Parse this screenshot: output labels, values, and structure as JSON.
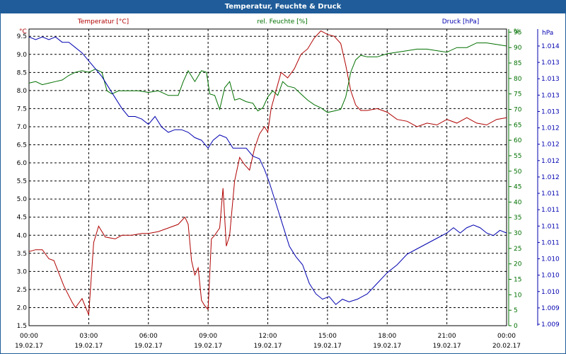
{
  "window": {
    "title": "Temperatur, Feuchte & Druck"
  },
  "colors": {
    "temperature": "#b00000",
    "humidity": "#007000",
    "pressure": "#0000b0",
    "grid": "#000000"
  },
  "chart_data": {
    "type": "line",
    "title": "Temperatur, Feuchte & Druck",
    "grid": true,
    "x": {
      "range": [
        "19.02.17 00:00",
        "20.02.17 00:00"
      ],
      "ticks": [
        {
          "time": "00:00",
          "date": "19.02.17"
        },
        {
          "time": "03:00",
          "date": "19.02.17"
        },
        {
          "time": "06:00",
          "date": "19.02.17"
        },
        {
          "time": "09:00",
          "date": "19.02.17"
        },
        {
          "time": "12:00",
          "date": "19.02.17"
        },
        {
          "time": "15:00",
          "date": "19.02.17"
        },
        {
          "time": "18:00",
          "date": "19.02.17"
        },
        {
          "time": "21:00",
          "date": "19.02.17"
        },
        {
          "time": "00:00",
          "date": "20.02.17"
        }
      ]
    },
    "axes": {
      "temperature": {
        "unit": "°C",
        "range": [
          1.5,
          9.7
        ],
        "ticks": [
          "9.5",
          "9.0",
          "8.5",
          "8.0",
          "7.5",
          "7.0",
          "6.5",
          "6.0",
          "5.5",
          "5.0",
          "4.5",
          "4.0",
          "3.5",
          "3.0",
          "2.5",
          "2.0",
          "1.5"
        ]
      },
      "humidity": {
        "unit": "%",
        "range": [
          0,
          96
        ],
        "ticks": [
          "95",
          "90",
          "85",
          "80",
          "75",
          "70",
          "65",
          "60",
          "55",
          "50",
          "45",
          "40",
          "35",
          "30",
          "25",
          "20",
          "15",
          "10",
          "5",
          "0"
        ]
      },
      "pressure": {
        "unit": "hPa",
        "range": [
          1008.6,
          1014.2
        ],
        "ticks": [
          "1.014",
          "1.013",
          "1.013",
          "1.013",
          "1.013",
          "1.012",
          "1.012",
          "1.012",
          "1.012",
          "1.011",
          "1.011",
          "1.011",
          "1.011",
          "1.010",
          "1.010",
          "1.010",
          "1.009",
          "1.009"
        ]
      }
    },
    "series": [
      {
        "name": "Temperatur [°C]",
        "axis": "temperature",
        "points": [
          [
            "19.02.17 00:00",
            3.55
          ],
          [
            "19.02.17 00:20",
            3.6
          ],
          [
            "19.02.17 00:40",
            3.6
          ],
          [
            "19.02.17 01:00",
            3.35
          ],
          [
            "19.02.17 01:15",
            3.3
          ],
          [
            "19.02.17 01:45",
            2.6
          ],
          [
            "19.02.17 02:10",
            2.15
          ],
          [
            "19.02.17 02:20",
            2.0
          ],
          [
            "19.02.17 02:40",
            2.25
          ],
          [
            "19.02.17 03:00",
            1.8
          ],
          [
            "19.02.17 03:15",
            3.8
          ],
          [
            "19.02.17 03:30",
            4.25
          ],
          [
            "19.02.17 03:50",
            3.95
          ],
          [
            "19.02.17 04:20",
            3.9
          ],
          [
            "19.02.17 04:40",
            4.0
          ],
          [
            "19.02.17 05:10",
            4.0
          ],
          [
            "19.02.17 05:40",
            4.05
          ],
          [
            "19.02.17 06:00",
            4.05
          ],
          [
            "19.02.17 06:30",
            4.1
          ],
          [
            "19.02.17 07:00",
            4.2
          ],
          [
            "19.02.17 07:30",
            4.3
          ],
          [
            "19.02.17 07:50",
            4.5
          ],
          [
            "19.02.17 08:00",
            4.3
          ],
          [
            "19.02.17 08:10",
            3.3
          ],
          [
            "19.02.17 08:20",
            2.9
          ],
          [
            "19.02.17 08:30",
            3.1
          ],
          [
            "19.02.17 08:40",
            2.2
          ],
          [
            "19.02.17 08:50",
            2.05
          ],
          [
            "19.02.17 09:00",
            1.95
          ],
          [
            "19.02.17 09:10",
            3.9
          ],
          [
            "19.02.17 09:20",
            4.0
          ],
          [
            "19.02.17 09:35",
            4.2
          ],
          [
            "19.02.17 09:45",
            5.3
          ],
          [
            "19.02.17 09:55",
            3.7
          ],
          [
            "19.02.17 10:05",
            4.0
          ],
          [
            "19.02.17 10:20",
            5.5
          ],
          [
            "19.02.17 10:35",
            6.15
          ],
          [
            "19.02.17 10:50",
            5.95
          ],
          [
            "19.02.17 11:05",
            5.8
          ],
          [
            "19.02.17 11:20",
            6.4
          ],
          [
            "19.02.17 11:35",
            6.8
          ],
          [
            "19.02.17 11:50",
            7.0
          ],
          [
            "19.02.17 12:00",
            6.85
          ],
          [
            "19.02.17 12:10",
            7.5
          ],
          [
            "19.02.17 12:25",
            8.0
          ],
          [
            "19.02.17 12:40",
            8.5
          ],
          [
            "19.02.17 13:00",
            8.35
          ],
          [
            "19.02.17 13:20",
            8.6
          ],
          [
            "19.02.17 13:40",
            9.0
          ],
          [
            "19.02.17 14:00",
            9.15
          ],
          [
            "19.02.17 14:20",
            9.45
          ],
          [
            "19.02.17 14:40",
            9.65
          ],
          [
            "19.02.17 15:00",
            9.55
          ],
          [
            "19.02.17 15:20",
            9.5
          ],
          [
            "19.02.17 15:40",
            9.3
          ],
          [
            "19.02.17 15:55",
            8.7
          ],
          [
            "19.02.17 16:10",
            8.0
          ],
          [
            "19.02.17 16:25",
            7.6
          ],
          [
            "19.02.17 16:40",
            7.45
          ],
          [
            "19.02.17 17:00",
            7.45
          ],
          [
            "19.02.17 17:30",
            7.5
          ],
          [
            "19.02.17 18:00",
            7.4
          ],
          [
            "19.02.17 18:30",
            7.2
          ],
          [
            "19.02.17 19:00",
            7.15
          ],
          [
            "19.02.17 19:30",
            7.0
          ],
          [
            "19.02.17 20:00",
            7.1
          ],
          [
            "19.02.17 20:30",
            7.05
          ],
          [
            "19.02.17 21:00",
            7.2
          ],
          [
            "19.02.17 21:30",
            7.1
          ],
          [
            "19.02.17 22:00",
            7.25
          ],
          [
            "19.02.17 22:30",
            7.1
          ],
          [
            "19.02.17 23:00",
            7.05
          ],
          [
            "19.02.17 23:30",
            7.2
          ],
          [
            "20.02.17 00:00",
            7.25
          ]
        ]
      },
      {
        "name": "rel. Feuchte [%]",
        "axis": "humidity",
        "points": [
          [
            "19.02.17 00:00",
            78.5
          ],
          [
            "19.02.17 00:20",
            79.0
          ],
          [
            "19.02.17 00:40",
            78.0
          ],
          [
            "19.02.17 01:00",
            78.5
          ],
          [
            "19.02.17 01:20",
            79.0
          ],
          [
            "19.02.17 01:40",
            79.5
          ],
          [
            "19.02.17 02:00",
            81.0
          ],
          [
            "19.02.17 02:20",
            82.0
          ],
          [
            "19.02.17 02:40",
            82.5
          ],
          [
            "19.02.17 03:00",
            82.0
          ],
          [
            "19.02.17 03:20",
            83.0
          ],
          [
            "19.02.17 03:40",
            82.0
          ],
          [
            "19.02.17 03:55",
            76.0
          ],
          [
            "19.02.17 04:10",
            75.0
          ],
          [
            "19.02.17 04:30",
            76.0
          ],
          [
            "19.02.17 05:00",
            76.0
          ],
          [
            "19.02.17 05:30",
            76.0
          ],
          [
            "19.02.17 06:00",
            75.5
          ],
          [
            "19.02.17 06:30",
            76.0
          ],
          [
            "19.02.17 07:00",
            74.5
          ],
          [
            "19.02.17 07:30",
            74.5
          ],
          [
            "19.02.17 07:45",
            79.0
          ],
          [
            "19.02.17 08:00",
            82.5
          ],
          [
            "19.02.17 08:20",
            79.0
          ],
          [
            "19.02.17 08:40",
            82.5
          ],
          [
            "19.02.17 08:55",
            82.0
          ],
          [
            "19.02.17 09:05",
            75.0
          ],
          [
            "19.02.17 09:20",
            74.5
          ],
          [
            "19.02.17 09:35",
            70.0
          ],
          [
            "19.02.17 09:50",
            77.0
          ],
          [
            "19.02.17 10:05",
            79.0
          ],
          [
            "19.02.17 10:20",
            73.0
          ],
          [
            "19.02.17 10:35",
            73.5
          ],
          [
            "19.02.17 10:55",
            72.5
          ],
          [
            "19.02.17 11:15",
            72.0
          ],
          [
            "19.02.17 11:30",
            69.5
          ],
          [
            "19.02.17 11:45",
            70.5
          ],
          [
            "19.02.17 12:00",
            74.0
          ],
          [
            "19.02.17 12:15",
            76.0
          ],
          [
            "19.02.17 12:30",
            74.5
          ],
          [
            "19.02.17 12:45",
            79.0
          ],
          [
            "19.02.17 13:00",
            77.5
          ],
          [
            "19.02.17 13:20",
            77.0
          ],
          [
            "19.02.17 13:40",
            75.0
          ],
          [
            "19.02.17 14:00",
            73.0
          ],
          [
            "19.02.17 14:20",
            71.5
          ],
          [
            "19.02.17 14:40",
            70.5
          ],
          [
            "19.02.17 15:00",
            69.0
          ],
          [
            "19.02.17 15:20",
            69.5
          ],
          [
            "19.02.17 15:40",
            70.0
          ],
          [
            "19.02.17 15:55",
            74.0
          ],
          [
            "19.02.17 16:10",
            82.0
          ],
          [
            "19.02.17 16:25",
            86.0
          ],
          [
            "19.02.17 16:40",
            87.5
          ],
          [
            "19.02.17 17:00",
            87.0
          ],
          [
            "19.02.17 17:30",
            87.0
          ],
          [
            "19.02.17 18:00",
            88.0
          ],
          [
            "19.02.17 18:30",
            88.5
          ],
          [
            "19.02.17 19:00",
            89.0
          ],
          [
            "19.02.17 19:30",
            89.5
          ],
          [
            "19.02.17 20:00",
            89.5
          ],
          [
            "19.02.17 20:30",
            89.0
          ],
          [
            "19.02.17 21:00",
            88.5
          ],
          [
            "19.02.17 21:30",
            90.0
          ],
          [
            "19.02.17 22:00",
            90.0
          ],
          [
            "19.02.17 22:30",
            91.5
          ],
          [
            "19.02.17 23:00",
            91.5
          ],
          [
            "19.02.17 23:30",
            91.0
          ],
          [
            "20.02.17 00:00",
            90.5
          ]
        ]
      },
      {
        "name": "Druck [hPa]",
        "axis": "pressure",
        "points": [
          [
            "19.02.17 00:00",
            1014.05
          ],
          [
            "19.02.17 00:20",
            1014.0
          ],
          [
            "19.02.17 00:40",
            1014.05
          ],
          [
            "19.02.17 01:00",
            1014.0
          ],
          [
            "19.02.17 01:20",
            1014.05
          ],
          [
            "19.02.17 01:40",
            1013.95
          ],
          [
            "19.02.17 02:00",
            1013.95
          ],
          [
            "19.02.17 02:20",
            1013.85
          ],
          [
            "19.02.17 02:40",
            1013.75
          ],
          [
            "19.02.17 03:00",
            1013.6
          ],
          [
            "19.02.17 03:20",
            1013.45
          ],
          [
            "19.02.17 03:40",
            1013.3
          ],
          [
            "19.02.17 04:00",
            1013.1
          ],
          [
            "19.02.17 04:20",
            1012.9
          ],
          [
            "19.02.17 04:40",
            1012.7
          ],
          [
            "19.02.17 05:00",
            1012.55
          ],
          [
            "19.02.17 05:20",
            1012.55
          ],
          [
            "19.02.17 05:40",
            1012.5
          ],
          [
            "19.02.17 06:00",
            1012.4
          ],
          [
            "19.02.17 06:20",
            1012.55
          ],
          [
            "19.02.17 06:40",
            1012.35
          ],
          [
            "19.02.17 07:00",
            1012.25
          ],
          [
            "19.02.17 07:20",
            1012.3
          ],
          [
            "19.02.17 07:40",
            1012.3
          ],
          [
            "19.02.17 08:00",
            1012.25
          ],
          [
            "19.02.17 08:20",
            1012.15
          ],
          [
            "19.02.17 08:40",
            1012.1
          ],
          [
            "19.02.17 09:00",
            1011.95
          ],
          [
            "19.02.17 09:15",
            1012.1
          ],
          [
            "19.02.17 09:35",
            1012.2
          ],
          [
            "19.02.17 09:55",
            1012.15
          ],
          [
            "19.02.17 10:15",
            1011.95
          ],
          [
            "19.02.17 10:35",
            1011.95
          ],
          [
            "19.02.17 10:55",
            1011.95
          ],
          [
            "19.02.17 11:15",
            1011.8
          ],
          [
            "19.02.17 11:35",
            1011.75
          ],
          [
            "19.02.17 11:50",
            1011.55
          ],
          [
            "19.02.17 12:05",
            1011.3
          ],
          [
            "19.02.17 12:25",
            1010.9
          ],
          [
            "19.02.17 12:45",
            1010.5
          ],
          [
            "19.02.17 13:05",
            1010.1
          ],
          [
            "19.02.17 13:25",
            1009.9
          ],
          [
            "19.02.17 13:45",
            1009.75
          ],
          [
            "19.02.17 14:05",
            1009.4
          ],
          [
            "19.02.17 14:25",
            1009.2
          ],
          [
            "19.02.17 14:45",
            1009.1
          ],
          [
            "19.02.17 15:05",
            1009.15
          ],
          [
            "19.02.17 15:25",
            1009.0
          ],
          [
            "19.02.17 15:45",
            1009.1
          ],
          [
            "19.02.17 16:05",
            1009.05
          ],
          [
            "19.02.17 16:30",
            1009.1
          ],
          [
            "19.02.17 17:00",
            1009.2
          ],
          [
            "19.02.17 17:30",
            1009.4
          ],
          [
            "19.02.17 18:00",
            1009.6
          ],
          [
            "19.02.17 18:30",
            1009.75
          ],
          [
            "19.02.17 19:00",
            1009.95
          ],
          [
            "19.02.17 19:30",
            1010.05
          ],
          [
            "19.02.17 20:00",
            1010.15
          ],
          [
            "19.02.17 20:30",
            1010.25
          ],
          [
            "19.02.17 21:00",
            1010.35
          ],
          [
            "19.02.17 21:20",
            1010.45
          ],
          [
            "19.02.17 21:40",
            1010.35
          ],
          [
            "19.02.17 22:00",
            1010.45
          ],
          [
            "19.02.17 22:20",
            1010.5
          ],
          [
            "19.02.17 22:40",
            1010.45
          ],
          [
            "19.02.17 23:00",
            1010.35
          ],
          [
            "19.02.17 23:20",
            1010.3
          ],
          [
            "19.02.17 23:40",
            1010.4
          ],
          [
            "20.02.17 00:00",
            1010.35
          ]
        ]
      }
    ]
  }
}
